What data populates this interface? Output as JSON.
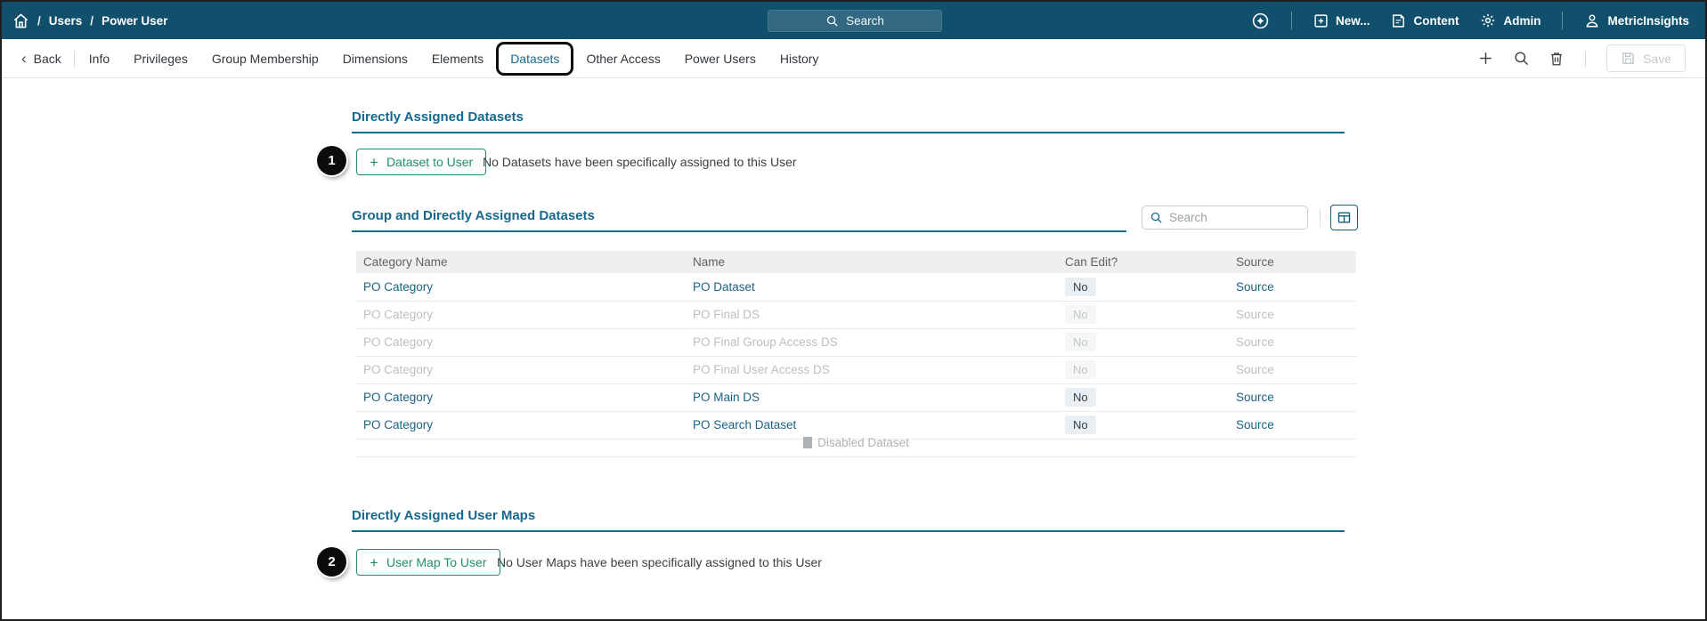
{
  "topbar": {
    "breadcrumb": {
      "separator": "/",
      "items": [
        "Users",
        "Power User"
      ]
    },
    "search_label": "Search",
    "actions": {
      "new_label": "New...",
      "content_label": "Content",
      "admin_label": "Admin",
      "account_label": "MetricInsights"
    }
  },
  "tabbar": {
    "back_label": "Back",
    "tabs": [
      {
        "label": "Info"
      },
      {
        "label": "Privileges"
      },
      {
        "label": "Group Membership"
      },
      {
        "label": "Dimensions"
      },
      {
        "label": "Elements"
      },
      {
        "label": "Datasets",
        "active": true
      },
      {
        "label": "Other Access"
      },
      {
        "label": "Power Users"
      },
      {
        "label": "History"
      }
    ],
    "save_label": "Save"
  },
  "sections": {
    "directly_assigned": {
      "annotation_number": "1",
      "title": "Directly Assigned Datasets",
      "add_button_label": "Dataset to User",
      "empty_text": "No Datasets have been specifically assigned to this User"
    },
    "group_assigned": {
      "title": "Group and Directly Assigned Datasets",
      "search_placeholder": "Search",
      "table": {
        "columns": [
          "Category Name",
          "Name",
          "Can Edit?",
          "Source"
        ],
        "rows": [
          {
            "category": "PO Category",
            "name": "PO Dataset",
            "can_edit": "No",
            "source": "Source",
            "disabled": false
          },
          {
            "category": "PO Category",
            "name": "PO Final DS",
            "can_edit": "No",
            "source": "Source",
            "disabled": true
          },
          {
            "category": "PO Category",
            "name": "PO Final Group Access DS",
            "can_edit": "No",
            "source": "Source",
            "disabled": true
          },
          {
            "category": "PO Category",
            "name": "PO Final User Access DS",
            "can_edit": "No",
            "source": "Source",
            "disabled": true
          },
          {
            "category": "PO Category",
            "name": "PO Main DS",
            "can_edit": "No",
            "source": "Source",
            "disabled": false
          },
          {
            "category": "PO Category",
            "name": "PO Search Dataset",
            "can_edit": "No",
            "source": "Source",
            "disabled": false
          }
        ],
        "legend_label": "Disabled Dataset"
      }
    },
    "user_maps": {
      "annotation_number": "2",
      "title": "Directly Assigned User Maps",
      "add_button_label": "User Map To User",
      "empty_text": "No User Maps have been specifically assigned to this User"
    }
  },
  "colors": {
    "navbar_bg": "#11506d",
    "heading_teal": "#17688c",
    "link_teal": "#1a6385",
    "button_green": "#1f8f6d",
    "annotation_black": "#0c0c0c",
    "disabled_gray": "#bcbfc1"
  }
}
